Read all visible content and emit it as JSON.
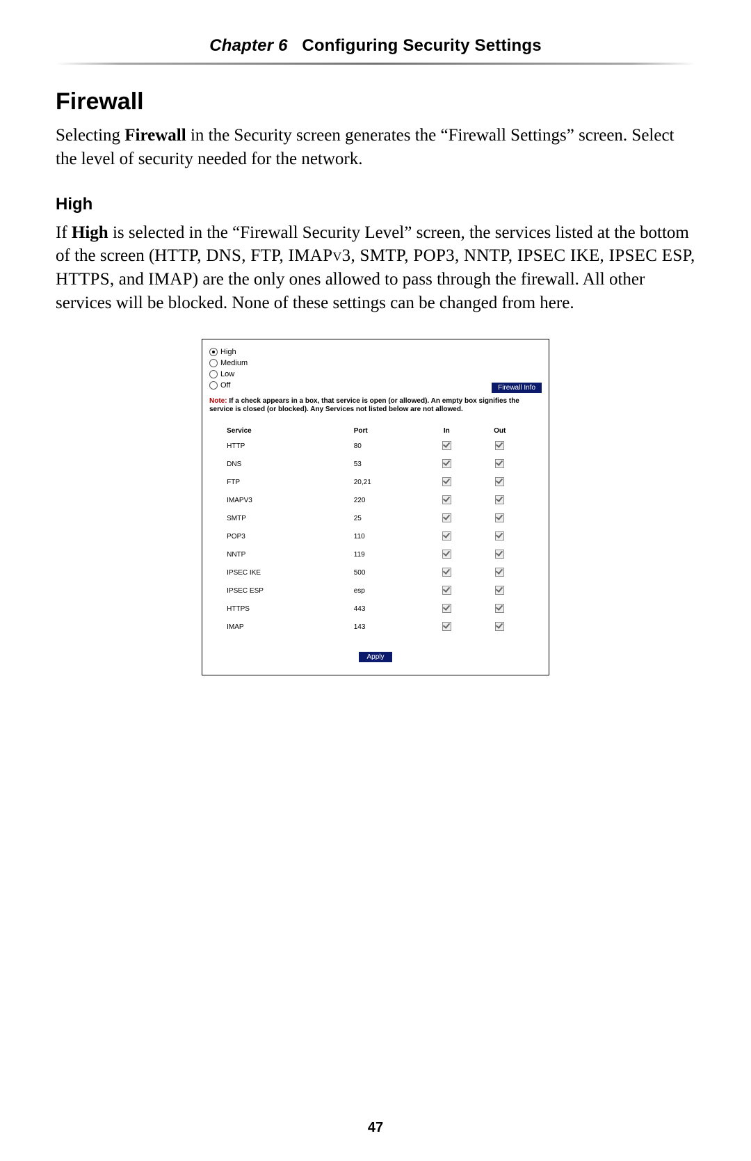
{
  "header": {
    "chapter_label": "Chapter 6",
    "chapter_title": "Configuring Security Settings"
  },
  "section": {
    "title": "Firewall",
    "intro_pre": "Selecting ",
    "intro_bold": "Firewall",
    "intro_post": " in the Security screen generates the “Firewall Settings” screen. Select the level of security needed for the network."
  },
  "sub": {
    "title": "High",
    "p_pre": "If ",
    "p_bold": "High",
    "p_mid": " is selected in the “Firewall Security Level” screen, the services listed at the bottom of the screen (",
    "p_services": "HTTP, DNS, FTP, IMAPv3, SMTP, POP3, NNTP, IPSEC IKE, IPSEC ESP, HTTPS,",
    "p_and": " and ",
    "p_imap": "IMAP",
    "p_post": ") are the only ones allowed to pass through the firewall. All other services will be blocked. None of these settings can be changed from here."
  },
  "panel": {
    "radios": [
      {
        "label": "High",
        "checked": true
      },
      {
        "label": "Medium",
        "checked": false
      },
      {
        "label": "Low",
        "checked": false
      },
      {
        "label": "Off",
        "checked": false
      }
    ],
    "info_button": "Firewall Info",
    "note_label": "Note:",
    "note_text": " If a check appears in a box, that service is open (or allowed). An empty box signifies the service is closed (or blocked). Any Services not listed below are not allowed.",
    "columns": {
      "service": "Service",
      "port": "Port",
      "in": "In",
      "out": "Out"
    },
    "rows": [
      {
        "service": "HTTP",
        "port": "80"
      },
      {
        "service": "DNS",
        "port": "53"
      },
      {
        "service": "FTP",
        "port": "20,21"
      },
      {
        "service": "IMAPV3",
        "port": "220"
      },
      {
        "service": "SMTP",
        "port": "25"
      },
      {
        "service": "POP3",
        "port": "110"
      },
      {
        "service": "NNTP",
        "port": "119"
      },
      {
        "service": "IPSEC IKE",
        "port": "500"
      },
      {
        "service": "IPSEC ESP",
        "port": "esp"
      },
      {
        "service": "HTTPS",
        "port": "443"
      },
      {
        "service": "IMAP",
        "port": "143"
      }
    ],
    "apply_button": "Apply"
  },
  "page_number": "47"
}
